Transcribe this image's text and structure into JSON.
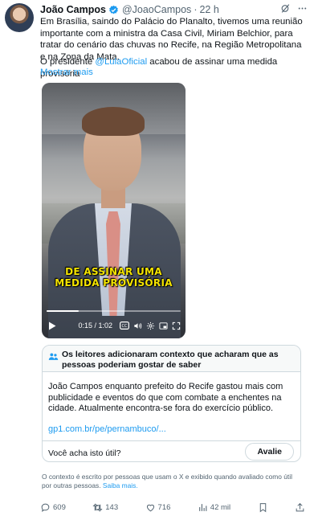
{
  "tweet": {
    "author_name": "João Campos",
    "handle": "@JoaoCampos",
    "separator": "·",
    "time": "22 h",
    "body": "Em Brasília, saindo do Palácio do Planalto, tivemos uma reunião importante com a ministra da Casa Civil, Miriam Belchior, para tratar do cenário das chuvas no Recife, na Região Metropolitana e na Zona da Mata.",
    "para2_prefix": "O presidente ",
    "para2_mention": "@LulaOficial",
    "para2_suffix": " acabou de assinar uma medida provisória",
    "show_more": "Mostrar mais"
  },
  "video": {
    "caption_line1": "DE ASSINAR UMA",
    "caption_line2": "MEDIDA PROVISÓRIA",
    "timecode": "0:15 / 1:02",
    "progress": 0.24
  },
  "community_note": {
    "title": "Os leitores adicionaram contexto que acharam que as pessoas poderiam gostar de saber",
    "text": "João Campos enquanto prefeito do Recife gastou mais com publicidade e eventos do que com combate a enchentes na cidade. Atualmente encontra-se fora do exercício público.",
    "link": "gp1.com.br/pe/pernambuco/...",
    "question": "Você acha isto útil?",
    "rate_label": "Avalie"
  },
  "disclaimer": {
    "text": "O contexto é escrito por pessoas que usam o X e exibido quando avaliado como útil por outras pessoas. ",
    "learn_more": "Saiba mais."
  },
  "actions": {
    "replies": "609",
    "reposts": "143",
    "likes": "716",
    "views": "42 mil"
  },
  "colors": {
    "accent": "#1d9bf0",
    "caption_yellow": "#f4e400",
    "muted": "#536471"
  }
}
